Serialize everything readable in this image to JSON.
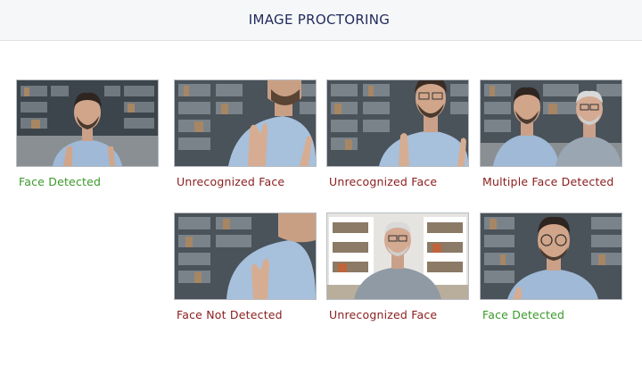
{
  "header": {
    "title": "IMAGE PROCTORING"
  },
  "colors": {
    "ok": "#3a9a2a",
    "bad": "#8a1c1c",
    "title": "#1f2a5c"
  },
  "cards": [
    {
      "label": "Face Detected",
      "status": "ok",
      "scene": "single-face-centered"
    },
    {
      "label": "Unrecognized Face",
      "status": "bad",
      "scene": "face-cropped-top"
    },
    {
      "label": "Unrecognized Face",
      "status": "bad",
      "scene": "face-partially-visible"
    },
    {
      "label": "Multiple Face Detected",
      "status": "bad",
      "scene": "two-faces"
    },
    {
      "label": "Face Not Detected",
      "status": "bad",
      "scene": "no-face-hand"
    },
    {
      "label": "Unrecognized Face",
      "status": "bad",
      "scene": "different-person"
    },
    {
      "label": "Face Detected",
      "status": "ok",
      "scene": "single-face-closeup"
    }
  ]
}
